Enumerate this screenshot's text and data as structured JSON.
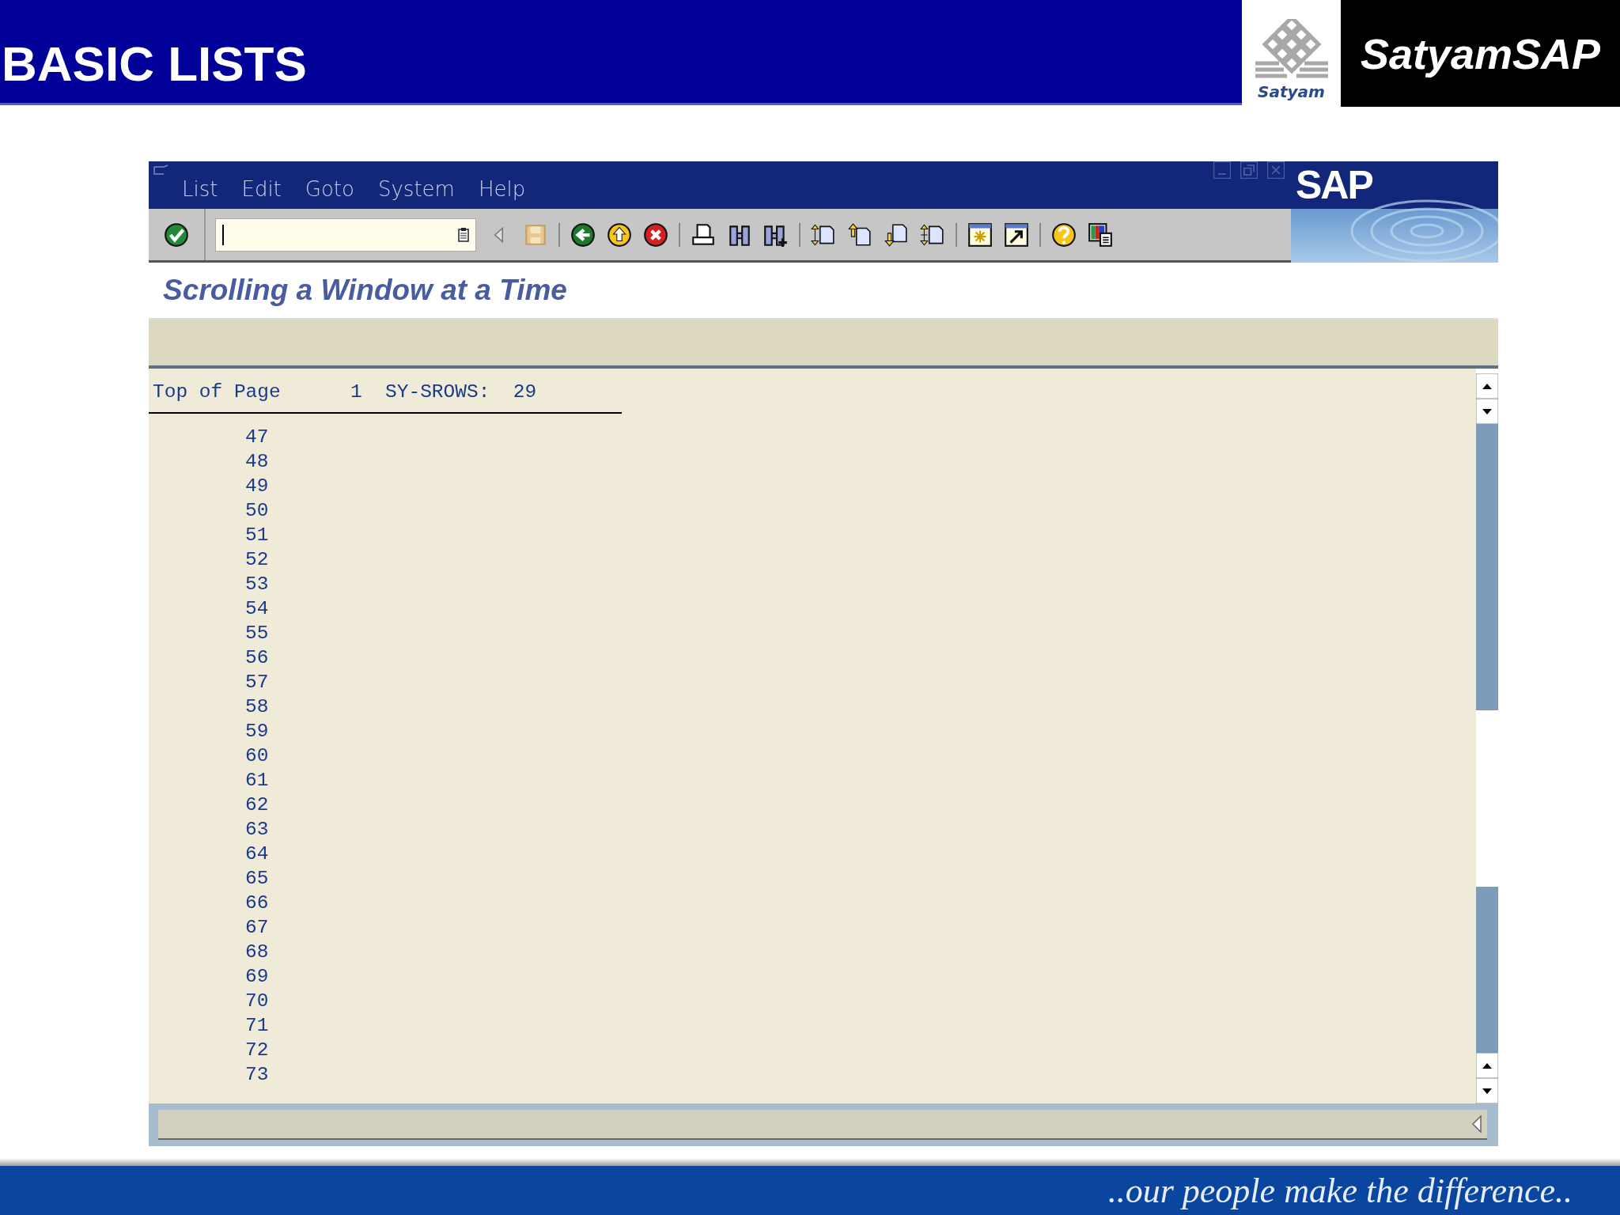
{
  "slide": {
    "title": "BASIC LISTS",
    "logo_caption": "Satyam",
    "brand": "SatyamSAP",
    "footer_tagline": "..our people make the difference.."
  },
  "sap_window": {
    "menu": [
      "List",
      "Edit",
      "Goto",
      "System",
      "Help"
    ],
    "sap_logo": "SAP",
    "screen_title": "Scrolling a Window at a Time",
    "list_header": "Top of Page      1  SY-SROWS:  29",
    "list_rows": [
      "47",
      "48",
      "49",
      "50",
      "51",
      "52",
      "53",
      "54",
      "55",
      "56",
      "57",
      "58",
      "59",
      "60",
      "61",
      "62",
      "63",
      "64",
      "65",
      "66",
      "67",
      "68",
      "69",
      "70",
      "71",
      "72",
      "73"
    ]
  }
}
